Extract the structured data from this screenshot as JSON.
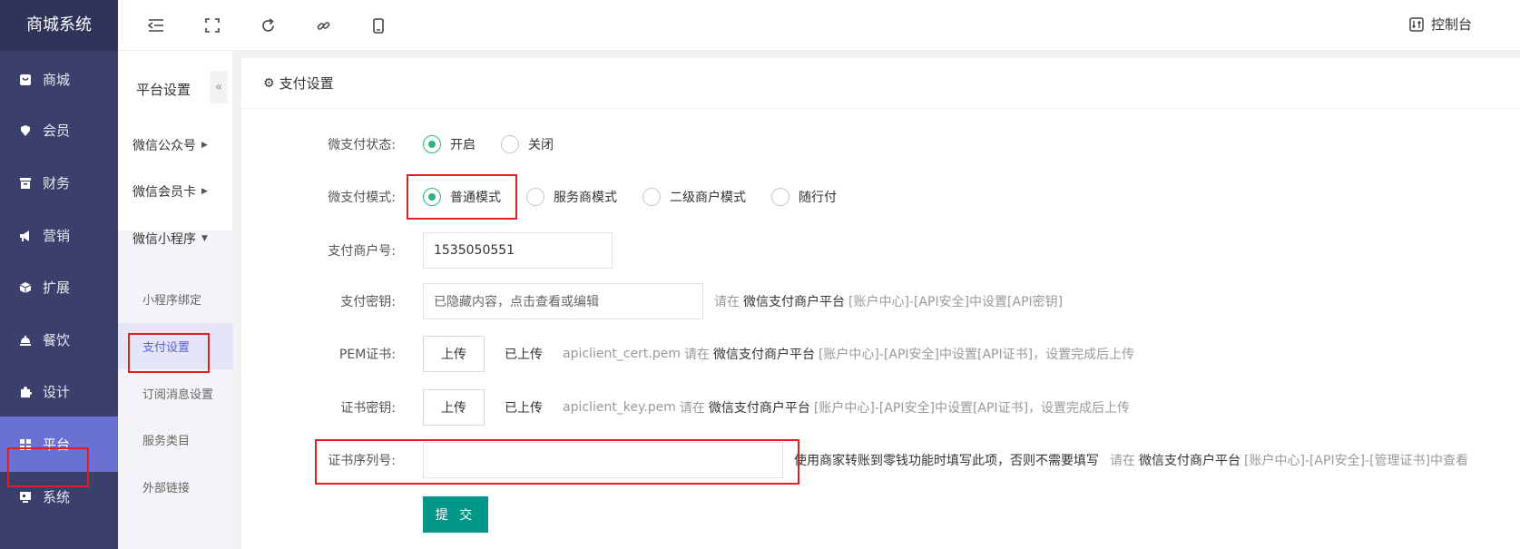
{
  "app": {
    "title": "商城系统"
  },
  "nav": [
    {
      "label": "商城",
      "icon": "shop-bag-icon"
    },
    {
      "label": "会员",
      "icon": "member-tag-icon"
    },
    {
      "label": "财务",
      "icon": "finance-box-icon"
    },
    {
      "label": "营销",
      "icon": "megaphone-icon"
    },
    {
      "label": "扩展",
      "icon": "cube-icon"
    },
    {
      "label": "餐饮",
      "icon": "food-cover-icon"
    },
    {
      "label": "设计",
      "icon": "puzzle-icon"
    },
    {
      "label": "平台",
      "icon": "grid-icon"
    },
    {
      "label": "系统",
      "icon": "monitor-icon"
    }
  ],
  "nav_active": "平台",
  "topbar": {
    "console_label": "控制台"
  },
  "submenu": {
    "title": "平台设置",
    "collapse_glyph": "«",
    "groups": [
      "微信公众号",
      "微信会员卡",
      "微信小程序"
    ],
    "items": [
      "小程序绑定",
      "支付设置",
      "订阅消息设置",
      "服务类目",
      "外部链接"
    ],
    "active_item": "支付设置"
  },
  "card": {
    "title": "支付设置"
  },
  "form": {
    "status_label": "微支付状态:",
    "status_options": [
      "开启",
      "关闭"
    ],
    "status_selected": "开启",
    "mode_label": "微支付模式:",
    "mode_options": [
      "普通模式",
      "服务商模式",
      "二级商户模式",
      "随行付"
    ],
    "mode_selected": "普通模式",
    "merchant_label": "支付商户号:",
    "merchant_value": "1535050551",
    "key_label": "支付密钥:",
    "key_placeholder": "已隐藏内容，点击查看或编辑",
    "key_help_pre": "请在",
    "key_help_platform": "微信支付商户平台",
    "key_help_post": "[账户中心]-[API安全]中设置[API密钥]",
    "pem_label": "PEM证书:",
    "upload_label": "上传",
    "uploaded_text": "已上传",
    "pem_file": "apiclient_cert.pem",
    "cert_help_pre": "请在",
    "cert_help_platform": "微信支付商户平台",
    "cert_help_post": "[账户中心]-[API安全]中设置[API证书]，设置完成后上传",
    "certkey_label": "证书密钥:",
    "certkey_file": "apiclient_key.pem",
    "serial_label": "证书序列号:",
    "serial_value": "",
    "serial_note": "使用商家转账到零钱功能时填写此项，否则不需要填写",
    "serial_help_pre": "请在",
    "serial_help_platform": "微信支付商户平台",
    "serial_help_post": "[账户中心]-[API安全]-[管理证书]中查看",
    "submit_label": "提 交"
  },
  "colors": {
    "sidebar": "#3b3f6b",
    "accent": "#6a71d4",
    "radio": "#2db57a",
    "submit": "#009688",
    "highlight": "#e02020"
  }
}
